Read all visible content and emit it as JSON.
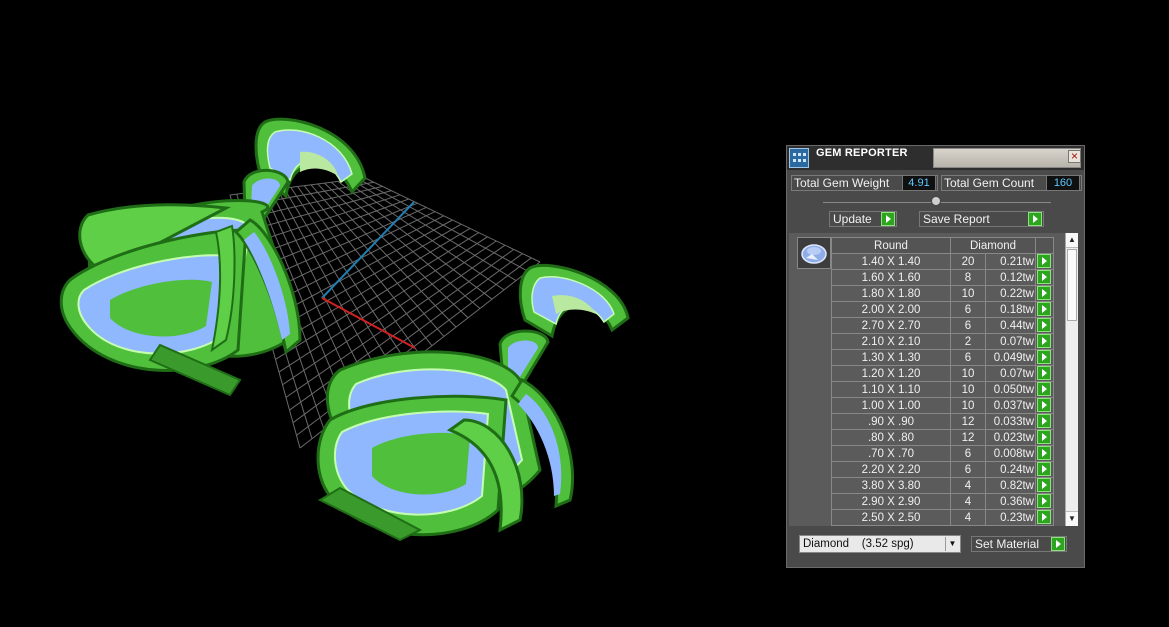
{
  "panel": {
    "title": "GEM REPORTER",
    "close_glyph": "×",
    "total_weight_label": "Total Gem Weight",
    "total_weight_value": "4.91",
    "total_count_label": "Total Gem Count",
    "total_count_value": "160",
    "update_label": "Update",
    "save_report_label": "Save Report",
    "table": {
      "headers": [
        "Round",
        "Diamond"
      ],
      "rows": [
        {
          "size": "1.40 X 1.40",
          "count": "20",
          "weight": "0.21tw"
        },
        {
          "size": "1.60 X 1.60",
          "count": "8",
          "weight": "0.12tw"
        },
        {
          "size": "1.80 X 1.80",
          "count": "10",
          "weight": "0.22tw"
        },
        {
          "size": "2.00 X 2.00",
          "count": "6",
          "weight": "0.18tw"
        },
        {
          "size": "2.70 X 2.70",
          "count": "6",
          "weight": "0.44tw"
        },
        {
          "size": "2.10 X 2.10",
          "count": "2",
          "weight": "0.07tw"
        },
        {
          "size": "1.30 X 1.30",
          "count": "6",
          "weight": "0.049tw"
        },
        {
          "size": "1.20 X 1.20",
          "count": "10",
          "weight": "0.07tw"
        },
        {
          "size": "1.10 X 1.10",
          "count": "10",
          "weight": "0.050tw"
        },
        {
          "size": "1.00 X 1.00",
          "count": "10",
          "weight": "0.037tw"
        },
        {
          "size": ".90 X .90",
          "count": "12",
          "weight": "0.033tw"
        },
        {
          "size": ".80 X .80",
          "count": "12",
          "weight": "0.023tw"
        },
        {
          "size": ".70 X .70",
          "count": "6",
          "weight": "0.008tw"
        },
        {
          "size": "2.20 X 2.20",
          "count": "6",
          "weight": "0.24tw"
        },
        {
          "size": "3.80 X 3.80",
          "count": "4",
          "weight": "0.82tw"
        },
        {
          "size": "2.90 X 2.90",
          "count": "4",
          "weight": "0.36tw"
        },
        {
          "size": "2.50 X 2.50",
          "count": "4",
          "weight": "0.23tw"
        }
      ]
    },
    "material_select": "Diamond    (3.52 spg)",
    "set_material_label": "Set Material",
    "scroll_up_glyph": "▲",
    "scroll_down_glyph": "▼",
    "select_arrow_glyph": "▼"
  },
  "colors": {
    "model_green": "#4fbf3c",
    "model_dark_green": "#1f6e16",
    "gem_blue": "#8fb8ff",
    "grid": "#6a6a6a",
    "axis_red": "#d22020",
    "axis_blue": "#1f7fb0",
    "value_text": "#5ec8ff",
    "go_button": "#2ea51f"
  }
}
